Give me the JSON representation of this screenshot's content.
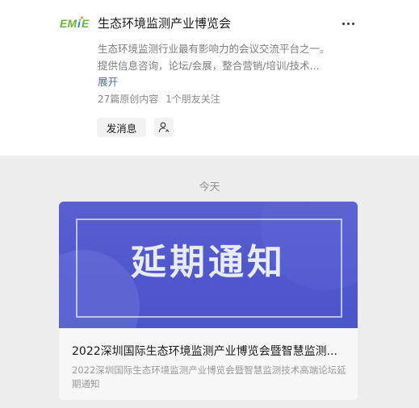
{
  "account": {
    "logo_text": "EMiE",
    "name": "生态环境监测产业博览会",
    "more_icon": "ellipsis-icon",
    "description_lines": [
      "生态环境监测行业最有影响力的会议交流平台之一。",
      "提供信息咨询，论坛/会展，整合营销/培训/技术..."
    ],
    "expand_label": "展开",
    "stats": {
      "articles": "27篇原创内容",
      "friends": "1个朋友关注"
    },
    "message_button": "发消息",
    "follow_icon": "user-follow-icon"
  },
  "feed": {
    "date_label": "今天",
    "article": {
      "cover_text": "延期通知",
      "title": "2022深圳国际生态环境监测产业博览会暨智慧监测...",
      "digest": "2022深圳国际生态环境监测产业博览会暨智慧监测技术高端论坛延期通知"
    }
  },
  "colors": {
    "link": "#576b95",
    "cover_blue": "#4f57cc",
    "feed_bg": "#ededed"
  }
}
